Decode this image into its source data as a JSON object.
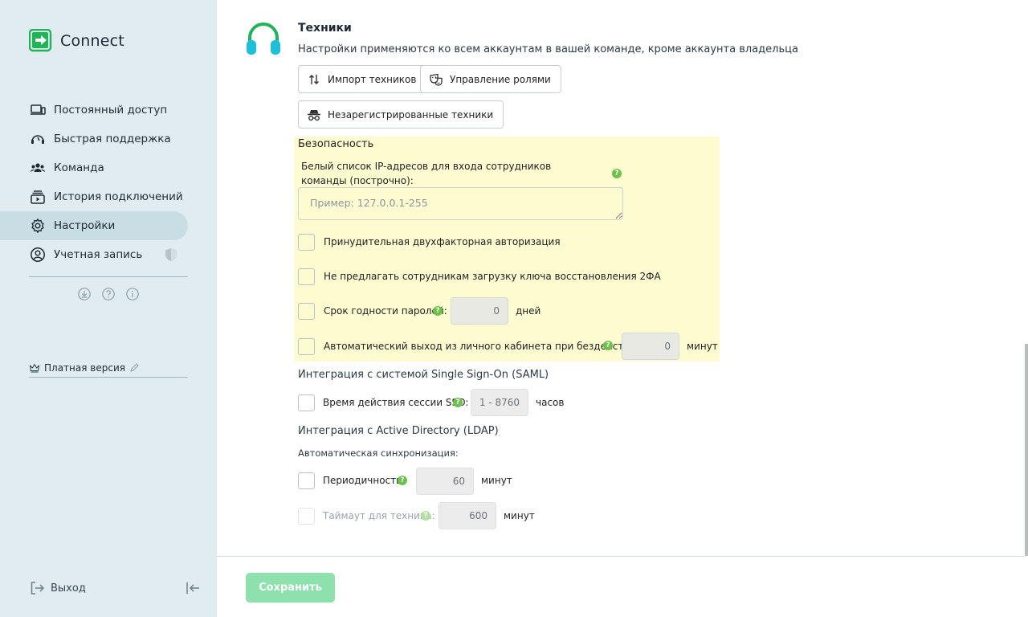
{
  "app": {
    "name": "Connect"
  },
  "sidebar": {
    "items": [
      {
        "label": "Постоянный доступ",
        "icon": "devices-icon"
      },
      {
        "label": "Быстрая поддержка",
        "icon": "support-icon"
      },
      {
        "label": "Команда",
        "icon": "team-icon"
      },
      {
        "label": "История подключений",
        "icon": "history-icon"
      },
      {
        "label": "Настройки",
        "icon": "gear-icon",
        "active": true
      },
      {
        "label": "Учетная запись",
        "icon": "user-icon"
      }
    ],
    "plan_label": "Платная версия",
    "logout_label": "Выход"
  },
  "main": {
    "title": "Техники",
    "description": "Настройки применяются ко всем аккаунтам в вашей команде, кроме аккаунта владельца",
    "buttons": {
      "import": "Импорт техников",
      "roles": "Управление ролями",
      "unregistered": "Незарегистрированные техники"
    },
    "security": {
      "title": "Безопасность",
      "whitelist_label": "Белый список IP-адресов для входа сотрудников команды (построчно):",
      "whitelist_placeholder": "Пример: 127.0.0.1-255",
      "twofa_label": "Принудительная двухфакторная авторизация",
      "recovery_label": "Не предлагать сотрудникам загрузку ключа восстановления 2ФА",
      "password_expiry_label": "Срок годности паролей:",
      "password_expiry_value": "0",
      "password_expiry_unit": "дней",
      "auto_logout_label": "Автоматический выход из личного кабинета при бездействий:",
      "auto_logout_value": "0",
      "auto_logout_unit": "минут"
    },
    "saml": {
      "title": "Интеграция с системой Single Sign-On (SAML)",
      "sso_label": "Время действия сессии SSO:",
      "sso_placeholder": "1 - 8760",
      "sso_unit": "часов"
    },
    "ldap": {
      "title": "Интеграция с Active Directory (LDAP)",
      "auto_sync_label": "Автоматическая синхронизация:",
      "period_label": "Периодичность:",
      "period_value": "60",
      "period_unit": "минут",
      "timeout_label": "Таймаут для техника:",
      "timeout_value": "600",
      "timeout_unit": "минут"
    },
    "help_glyph": "?",
    "save_label": "Сохранить"
  },
  "colors": {
    "sidebar_bg": "#e0ecf0",
    "accent_green": "#6cc24a",
    "security_bg": "#fdfbd0",
    "save_bg": "#8ee0ad",
    "headset_green": "#22b35a",
    "headset_cyan": "#1fbfdc"
  }
}
